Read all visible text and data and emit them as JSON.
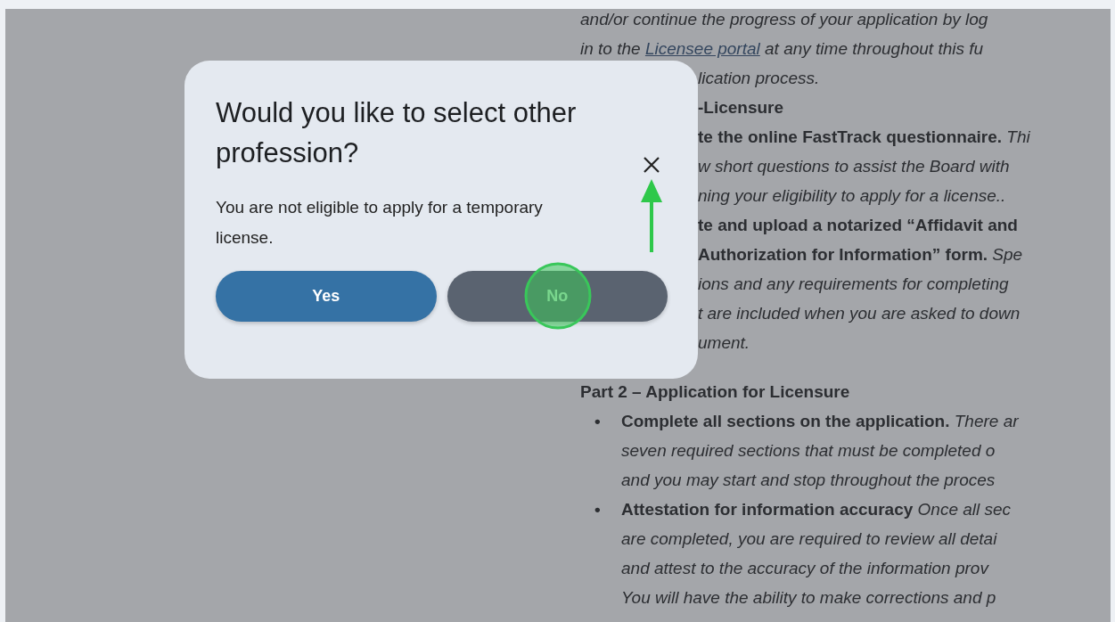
{
  "page": {
    "lines": [
      {
        "kind": "full",
        "text": "*and/or continue the progress of your application by log*"
      },
      {
        "kind": "link_line",
        "text": "*in to the* ",
        "link": "Licensee portal",
        "after": " *at any time throughout this fu*"
      },
      {
        "kind": "partial",
        "text": "*lication process.*"
      },
      {
        "kind": "partial",
        "text": "**-Licensure**"
      },
      {
        "kind": "partial",
        "text": "**te the online FastTrack questionnaire.** *Thi*"
      },
      {
        "kind": "partial",
        "text": "*w short questions to assist the Board with*"
      },
      {
        "kind": "partial",
        "text": "*ning your eligibility to apply for a license..*"
      },
      {
        "kind": "partial",
        "text": "**te and upload a notarized “Affidavit and**"
      },
      {
        "kind": "partial",
        "text": "**Authorization for Information” form.** *Spe*"
      },
      {
        "kind": "partial",
        "text": "*ions and any requirements for completing*"
      },
      {
        "kind": "partial",
        "text": "*t are included when you are asked to down*"
      },
      {
        "kind": "partial",
        "text": "*ument.*"
      },
      {
        "kind": "heading",
        "text": "Part 2 – Application for Licensure"
      },
      {
        "kind": "bullet",
        "bullet": "•",
        "text": "**Complete all sections on the application.** *There ar*"
      },
      {
        "kind": "continuation",
        "text": "*seven required sections that must be completed o*"
      },
      {
        "kind": "continuation",
        "text": "*and you may start and stop throughout the proces*"
      },
      {
        "kind": "bullet",
        "bullet": "•",
        "text": "**Attestation for information accuracy** *Once all sec*"
      },
      {
        "kind": "continuation",
        "text": "*are completed, you are required to review all detai*"
      },
      {
        "kind": "continuation",
        "text": "*and attest to the accuracy of the information prov*"
      },
      {
        "kind": "continuation",
        "text": "*You will have the ability to make corrections and p*"
      }
    ]
  },
  "dialog": {
    "title": "Would you like to select other profession?",
    "message": "You are not eligible to apply for a temporary license.",
    "buttons": [
      {
        "label": "Yes",
        "kind": "primary",
        "highlighted": false
      },
      {
        "label": "No",
        "kind": "secondary",
        "highlighted": true
      }
    ],
    "close_hint": true
  }
}
